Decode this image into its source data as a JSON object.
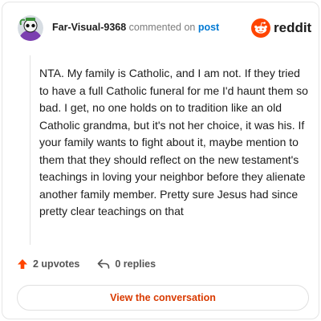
{
  "header": {
    "username": "Far-Visual-9368",
    "action_text": " commented on ",
    "post_link": "post",
    "brand": "reddit"
  },
  "comment": {
    "body": "NTA. My family is Catholic, and I am not. If they tried to have a full Catholic funeral for me I'd haunt them so bad. I get, no one holds on to tradition like an old Catholic grandma, but it's not her choice, it was his. If your family wants to fight about it, maybe mention to them that they should reflect on the new testament's teachings in loving your neighbor before they alienate another family member. Pretty sure Jesus had since pretty clear teachings on that"
  },
  "actions": {
    "upvotes": "2 upvotes",
    "replies": "0 replies"
  },
  "cta": {
    "label": "View the conversation"
  },
  "colors": {
    "brand": "#ff4500",
    "link": "#0079d3",
    "cta": "#d93a00"
  },
  "icons": [
    "avatar-icon",
    "reddit-logo-icon",
    "upvote-arrow-icon",
    "reply-icon"
  ]
}
